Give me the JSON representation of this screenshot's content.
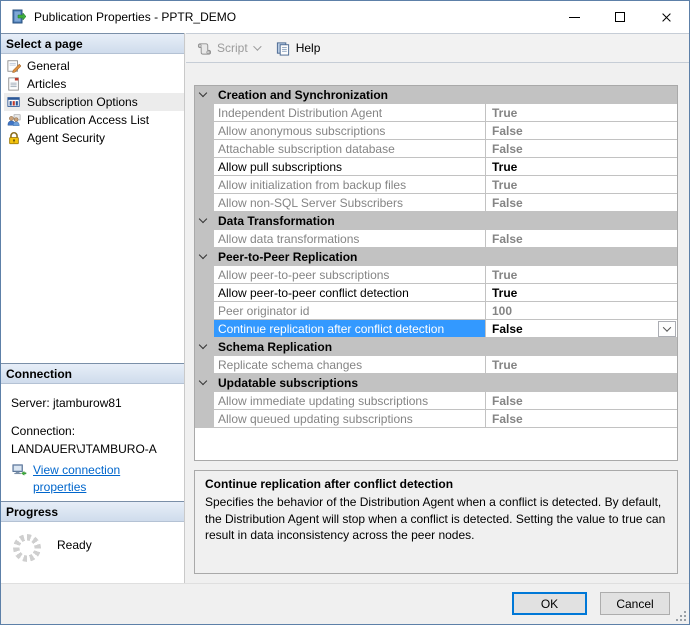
{
  "window": {
    "title": "Publication Properties - PPTR_DEMO"
  },
  "titlebar_controls": {
    "minimize": "minimize",
    "maximize": "maximize",
    "close": "close"
  },
  "sidebar": {
    "header": "Select a page",
    "items": [
      {
        "label": "General",
        "icon": "general-icon",
        "selected": false
      },
      {
        "label": "Articles",
        "icon": "articles-icon",
        "selected": false
      },
      {
        "label": "Subscription Options",
        "icon": "subscription-options-icon",
        "selected": true
      },
      {
        "label": "Publication Access List",
        "icon": "publication-access-icon",
        "selected": false
      },
      {
        "label": "Agent Security",
        "icon": "agent-security-icon",
        "selected": false
      }
    ],
    "connection": {
      "header": "Connection",
      "server": "Server: jtamburow81",
      "connection_label": "Connection:",
      "connection_value": "LANDAUER\\JTAMBURO-A",
      "link": "View connection properties",
      "link_icon": "connection-properties-icon"
    },
    "progress": {
      "header": "Progress",
      "status": "Ready",
      "icon": "spinner-icon"
    }
  },
  "toolbar": {
    "script": "Script",
    "script_icon": "script-icon",
    "help": "Help",
    "help_icon": "help-icon"
  },
  "grid": {
    "rows": [
      {
        "kind": "category",
        "label": "Creation and Synchronization"
      },
      {
        "kind": "prop",
        "label": "Independent Distribution Agent",
        "value": "True",
        "state": "disabled"
      },
      {
        "kind": "prop",
        "label": "Allow anonymous subscriptions",
        "value": "False",
        "state": "disabled"
      },
      {
        "kind": "prop",
        "label": "Attachable subscription database",
        "value": "False",
        "state": "disabled"
      },
      {
        "kind": "prop",
        "label": "Allow pull subscriptions",
        "value": "True",
        "state": "enabled"
      },
      {
        "kind": "prop",
        "label": "Allow initialization from backup files",
        "value": "True",
        "state": "disabled"
      },
      {
        "kind": "prop",
        "label": "Allow non-SQL Server Subscribers",
        "value": "False",
        "state": "disabled"
      },
      {
        "kind": "category",
        "label": "Data Transformation"
      },
      {
        "kind": "prop",
        "label": "Allow data transformations",
        "value": "False",
        "state": "disabled"
      },
      {
        "kind": "category",
        "label": "Peer-to-Peer Replication"
      },
      {
        "kind": "prop",
        "label": "Allow peer-to-peer subscriptions",
        "value": "True",
        "state": "disabled"
      },
      {
        "kind": "prop",
        "label": "Allow peer-to-peer conflict detection",
        "value": "True",
        "state": "enabled"
      },
      {
        "kind": "prop",
        "label": "Peer originator id",
        "value": "100",
        "state": "disabled"
      },
      {
        "kind": "prop",
        "label": "Continue replication after conflict detection",
        "value": "False",
        "state": "selected",
        "dropdown": true
      },
      {
        "kind": "category",
        "label": "Schema Replication"
      },
      {
        "kind": "prop",
        "label": "Replicate schema changes",
        "value": "True",
        "state": "disabled"
      },
      {
        "kind": "category",
        "label": "Updatable subscriptions"
      },
      {
        "kind": "prop",
        "label": "Allow immediate updating subscriptions",
        "value": "False",
        "state": "disabled"
      },
      {
        "kind": "prop",
        "label": "Allow queued updating subscriptions",
        "value": "False",
        "state": "disabled"
      }
    ]
  },
  "description": {
    "title": "Continue replication after conflict detection",
    "body": "Specifies the behavior of the Distribution Agent when a conflict is detected. By default, the Distribution Agent will stop when a conflict is detected. Setting the value to true can result in data inconsistency across the peer nodes."
  },
  "footer": {
    "ok": "OK",
    "cancel": "Cancel"
  },
  "colors": {
    "selection_blue": "#3399ff",
    "category_gray": "#c2c2c2",
    "disabled_text": "#848484",
    "link_blue": "#0066cc",
    "ok_focus_border": "#0078d7",
    "window_border": "#5d80a8"
  }
}
